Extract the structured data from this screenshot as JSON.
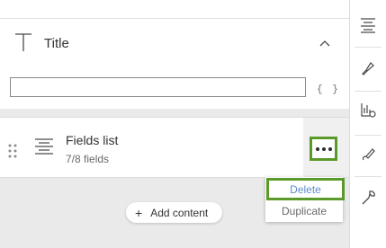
{
  "title_section": {
    "label": "Title",
    "input_value": "",
    "expression_label": "{ }"
  },
  "fields_list": {
    "title": "Fields list",
    "subtitle": "7/8 fields"
  },
  "context_menu": {
    "delete_label": "Delete",
    "duplicate_label": "Duplicate"
  },
  "add_content": {
    "label": "Add content"
  },
  "rail": {
    "items": [
      "list-layout-icon",
      "style-brush-icon",
      "chart-settings-icon",
      "draw-pen-icon",
      "wrench-icon"
    ]
  },
  "colors": {
    "highlight": "#5a9a2a",
    "menu_active_text": "#5e8fc7",
    "panel_bg": "#eaeaea"
  }
}
